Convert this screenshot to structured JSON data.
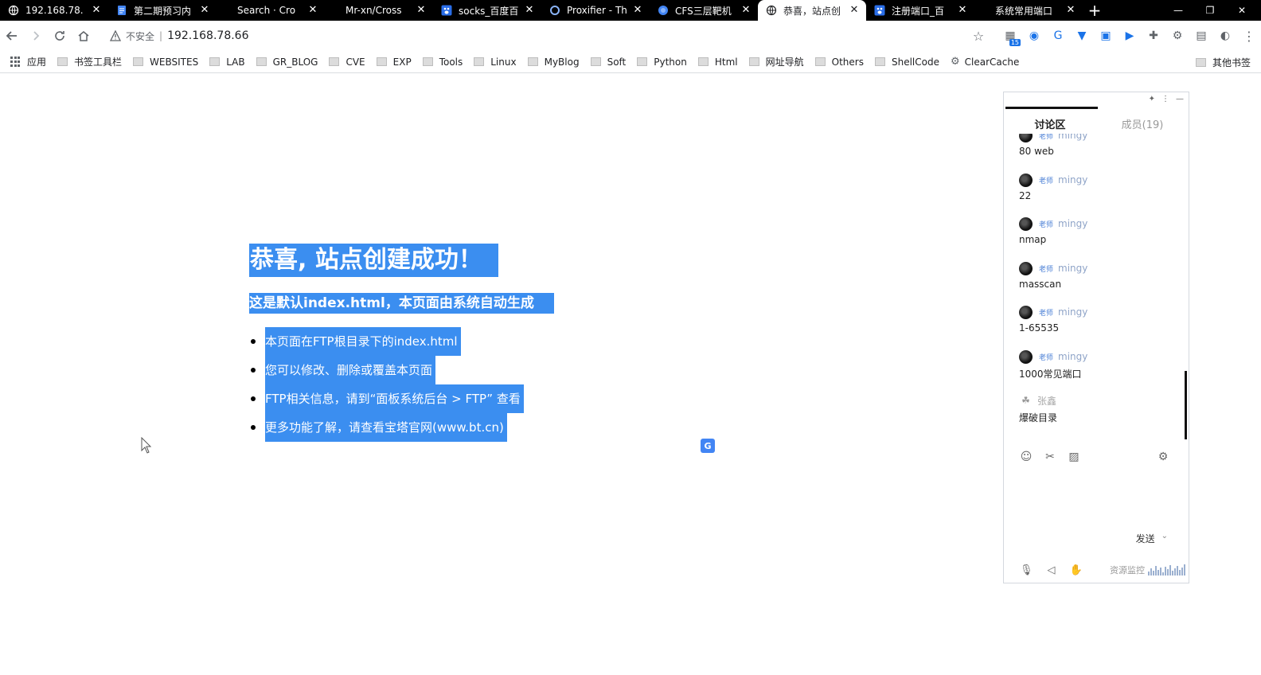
{
  "tabs": [
    {
      "title": "192.168.78.",
      "icon": "globe-icon",
      "active": false
    },
    {
      "title": "第二期预习内",
      "icon": "doc-icon",
      "active": false
    },
    {
      "title": "Search · Cro",
      "icon": "none",
      "active": false
    },
    {
      "title": "Mr-xn/Cross",
      "icon": "none",
      "active": false
    },
    {
      "title": "socks_百度百",
      "icon": "paw-icon",
      "active": false
    },
    {
      "title": "Proxifier - Th",
      "icon": "proxifier-icon",
      "active": false
    },
    {
      "title": "CFS三层靶机",
      "icon": "blue-circle-icon",
      "active": false
    },
    {
      "title": "恭喜，站点创",
      "icon": "globe-icon",
      "active": true
    },
    {
      "title": "注册端口_百",
      "icon": "paw-icon",
      "active": false
    },
    {
      "title": "系统常用端口",
      "icon": "none",
      "active": false
    }
  ],
  "toolbar": {
    "security_label": "不安全",
    "url": "192.168.78.66"
  },
  "extension_badge": "15",
  "bookmarks": [
    {
      "label": "应用",
      "kind": "apps"
    },
    {
      "label": "书签工具栏",
      "kind": "folder"
    },
    {
      "label": "WEBSITES",
      "kind": "folder"
    },
    {
      "label": "LAB",
      "kind": "folder"
    },
    {
      "label": "GR_BLOG",
      "kind": "folder"
    },
    {
      "label": "CVE",
      "kind": "folder"
    },
    {
      "label": "EXP",
      "kind": "folder"
    },
    {
      "label": "Tools",
      "kind": "folder"
    },
    {
      "label": "Linux",
      "kind": "folder"
    },
    {
      "label": "MyBlog",
      "kind": "folder"
    },
    {
      "label": "Soft",
      "kind": "folder"
    },
    {
      "label": "Python",
      "kind": "folder"
    },
    {
      "label": "Html",
      "kind": "folder"
    },
    {
      "label": "网址导航",
      "kind": "folder"
    },
    {
      "label": "Others",
      "kind": "folder"
    },
    {
      "label": "ShellCode",
      "kind": "folder"
    },
    {
      "label": "ClearCache",
      "kind": "gear"
    }
  ],
  "bookmarks_other": "其他书签",
  "page": {
    "heading": "恭喜, 站点创建成功！",
    "subheading": "这是默认index.html，本页面由系统自动生成",
    "items": [
      "本页面在FTP根目录下的index.html",
      "您可以修改、删除或覆盖本页面",
      "FTP相关信息，请到“面板系统后台 > FTP” 查看",
      "更多功能了解，请查看宝塔官网(www.bt.cn)"
    ],
    "selection_color": "#3b8ef0"
  },
  "chat": {
    "tab_discussion": "讨论区",
    "tab_members": "成员(19)",
    "messages": [
      {
        "role": "老师",
        "user": "mingy",
        "text": "80 web"
      },
      {
        "role": "老师",
        "user": "mingy",
        "text": "22"
      },
      {
        "role": "老师",
        "user": "mingy",
        "text": "nmap"
      },
      {
        "role": "老师",
        "user": "mingy",
        "text": "masscan"
      },
      {
        "role": "老师",
        "user": "mingy",
        "text": "1-65535"
      },
      {
        "role": "老师",
        "user": "mingy",
        "text": "1000常见端口"
      },
      {
        "role": "",
        "user": "张鑫",
        "text": "爆破目录"
      }
    ],
    "send_label": "发送",
    "monitor_label": "资源监控"
  }
}
